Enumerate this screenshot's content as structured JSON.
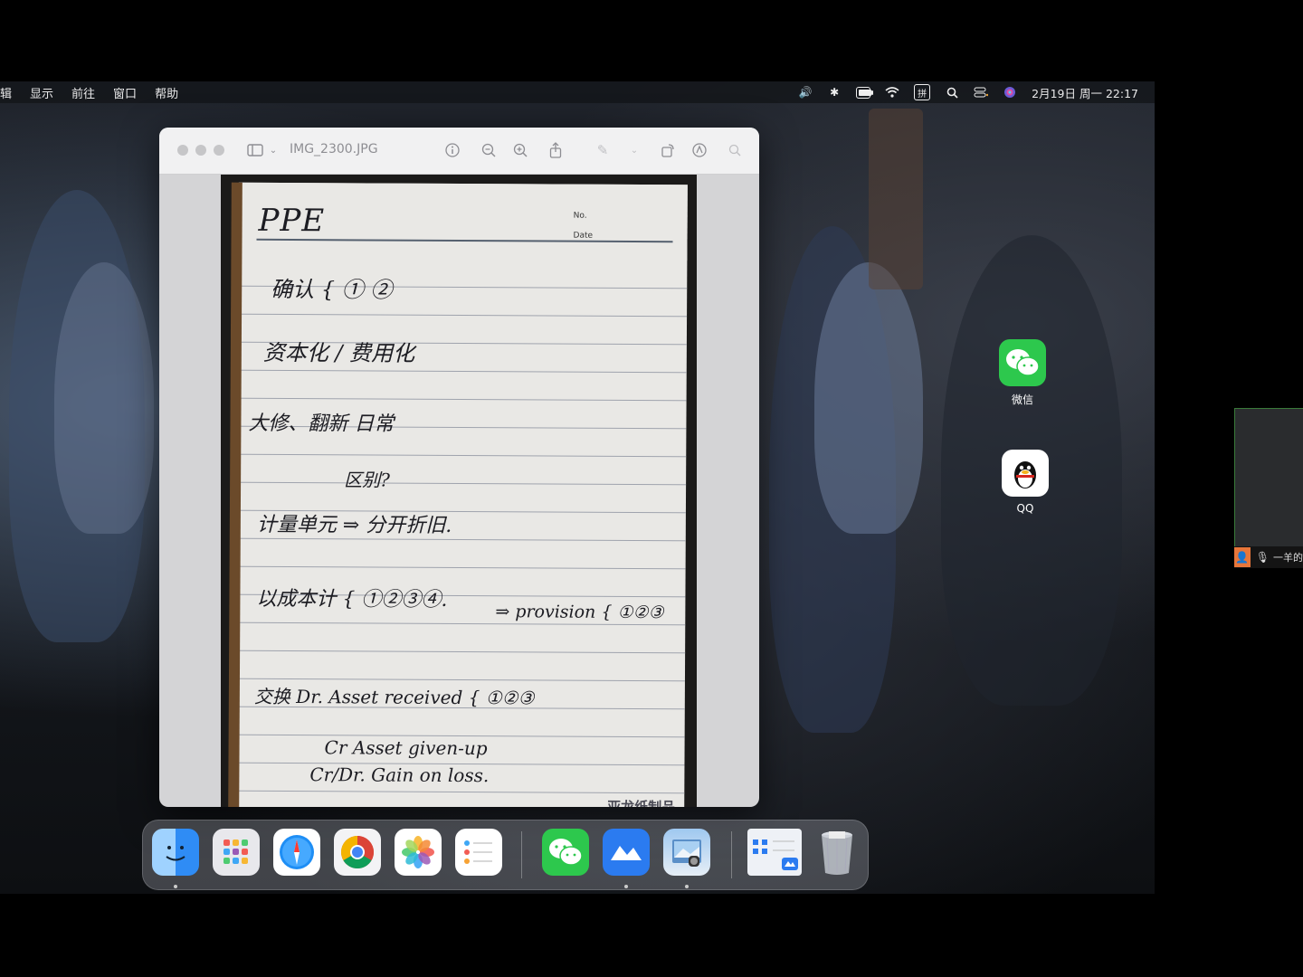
{
  "menubar": {
    "items": [
      "辑",
      "显示",
      "前往",
      "窗口",
      "帮助"
    ],
    "status_icons": [
      "volume-icon",
      "bluetooth-icon",
      "battery-icon",
      "wifi-icon",
      "pinyin-input-icon",
      "spotlight-icon",
      "control-center-icon",
      "siri-icon"
    ],
    "input_method": "拼",
    "clock": "2月19日 周一  22:17"
  },
  "preview_window": {
    "title": "IMG_2300.JPG",
    "toolbar_icons": [
      "sidebar-icon",
      "info-icon",
      "zoom-out-icon",
      "zoom-in-icon",
      "share-icon",
      "markup-icon",
      "rotate-icon",
      "annotate-icon",
      "search-icon"
    ]
  },
  "note": {
    "header": "PPE",
    "no_label": "No.",
    "date_label": "Date",
    "lines": [
      "确认 { ①  ②",
      "资本化 / 费用化",
      "大修、翻新      日常",
      "区别?",
      "计量单元 ⇒ 分开折旧.",
      "以成本计 { ①②③④.",
      "⇒ provision { ①②③",
      "交换  Dr. Asset received { ①②③",
      "Cr Asset given-up",
      "Cr/Dr. Gain on loss."
    ],
    "brand": "亚龙纸制品"
  },
  "desktop_icons": [
    {
      "label": "微信",
      "icon": "wechat-icon"
    },
    {
      "label": "QQ",
      "icon": "qq-penguin-icon"
    }
  ],
  "dock": {
    "apps": [
      "finder-icon",
      "launchpad-icon",
      "safari-icon",
      "chrome-icon",
      "photos-icon",
      "reminders-icon",
      "wechat-icon",
      "feishu-icon",
      "preview-icon",
      "feishu-meeting-window-icon",
      "trash-icon"
    ]
  },
  "side_panel": {
    "name": "一羊的"
  },
  "colors": {
    "wechat_green": "#2dc84d",
    "meeting_orange": "#e8763a",
    "chrome_red": "#db4437"
  }
}
